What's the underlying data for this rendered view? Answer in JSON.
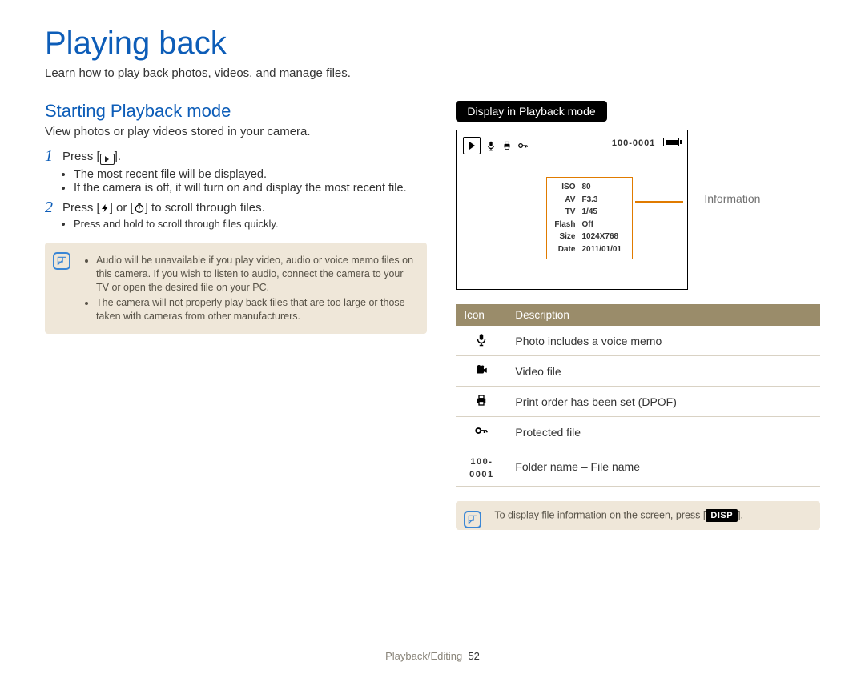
{
  "title": "Playing back",
  "intro": "Learn how to play back photos, videos, and manage files.",
  "section_heading": "Starting Playback mode",
  "section_sub": "View photos or play videos stored in your camera.",
  "steps": {
    "s1": {
      "text_pre": "Press [",
      "text_post": "].",
      "bullets": [
        "The most recent file will be displayed.",
        "If the camera is off, it will turn on and display the most recent file."
      ]
    },
    "s2": {
      "text_pre": "Press [",
      "text_mid": "] or [",
      "text_post": "] to scroll through files.",
      "sub": "Press and hold to scroll through files quickly."
    }
  },
  "note_left": [
    "Audio will be unavailable if you play video, audio or voice memo files on this camera. If you wish to listen to audio, connect the camera to your TV or open the desired file on your PC.",
    "The camera will not properly play back files that are too large or those taken with cameras from other manufacturers."
  ],
  "right": {
    "tab": "Display in Playback mode",
    "file_code": "100-0001",
    "info_label": "Information",
    "info_rows": [
      {
        "l": "ISO",
        "v": "80"
      },
      {
        "l": "AV",
        "v": "F3.3"
      },
      {
        "l": "TV",
        "v": "1/45"
      },
      {
        "l": "Flash",
        "v": "Off"
      },
      {
        "l": "Size",
        "v": "1024X768"
      },
      {
        "l": "Date",
        "v": "2011/01/01"
      }
    ],
    "table_head": {
      "c1": "Icon",
      "c2": "Description"
    },
    "table_rows": [
      {
        "icon": "mic",
        "desc": "Photo includes a voice memo"
      },
      {
        "icon": "video",
        "desc": "Video file"
      },
      {
        "icon": "print",
        "desc": "Print order has been set (DPOF)"
      },
      {
        "icon": "key",
        "desc": "Protected file"
      },
      {
        "icon": "filecode",
        "desc": "Folder name – File name"
      }
    ],
    "note": {
      "pre": "To display file information on the screen, press [",
      "post": "].",
      "disp": "DISP"
    }
  },
  "footer": {
    "section": "Playback/Editing",
    "page": "52"
  }
}
